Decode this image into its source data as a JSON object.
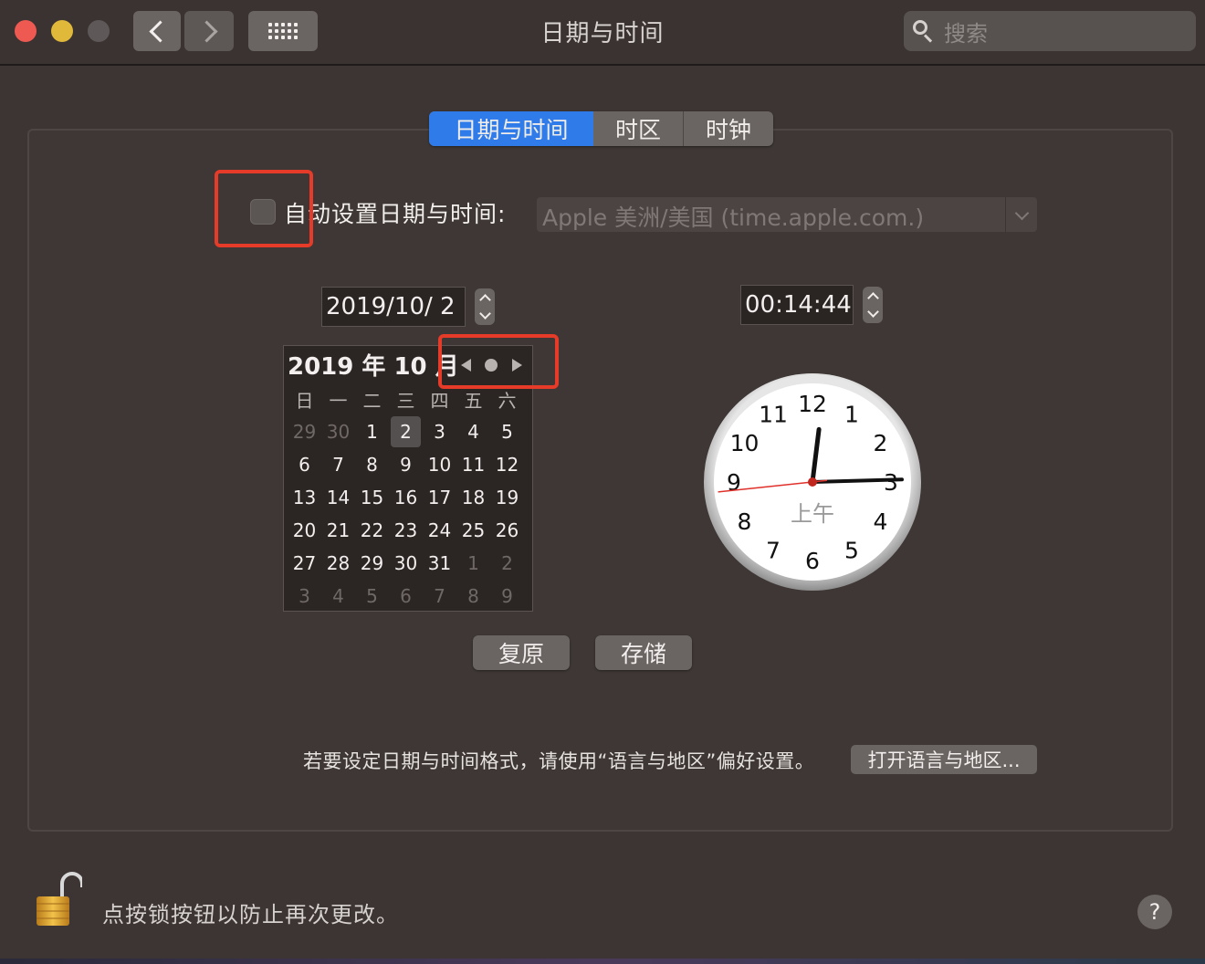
{
  "window": {
    "title": "日期与时间",
    "search_placeholder": "搜索"
  },
  "tabs": [
    {
      "label": "日期与时间",
      "selected": true
    },
    {
      "label": "时区",
      "selected": false
    },
    {
      "label": "时钟",
      "selected": false
    }
  ],
  "auto_set": {
    "label": "自动设置日期与时间:",
    "checked": false,
    "server_value": "Apple 美洲/美国 (time.apple.com.)"
  },
  "date_field": {
    "value": "2019/10/  2"
  },
  "time_field": {
    "value": "00:14:44"
  },
  "calendar": {
    "title": "2019 年 10 月",
    "weekdays": [
      "日",
      "一",
      "二",
      "三",
      "四",
      "五",
      "六"
    ],
    "weeks": [
      [
        "29",
        "30",
        "1",
        "2",
        "3",
        "4",
        "5"
      ],
      [
        "6",
        "7",
        "8",
        "9",
        "10",
        "11",
        "12"
      ],
      [
        "13",
        "14",
        "15",
        "16",
        "17",
        "18",
        "19"
      ],
      [
        "20",
        "21",
        "22",
        "23",
        "24",
        "25",
        "26"
      ],
      [
        "27",
        "28",
        "29",
        "30",
        "31",
        "1",
        "2"
      ],
      [
        "3",
        "4",
        "5",
        "6",
        "7",
        "8",
        "9"
      ]
    ],
    "selected_day": "2"
  },
  "clock": {
    "numbers": [
      "12",
      "1",
      "2",
      "3",
      "4",
      "5",
      "6",
      "7",
      "8",
      "9",
      "10",
      "11"
    ],
    "period": "上午",
    "hour": 0,
    "minute": 14,
    "second": 44
  },
  "buttons": {
    "revert": "复原",
    "save": "存储"
  },
  "format_hint": {
    "text": "若要设定日期与时间格式，请使用“语言与地区”偏好设置。",
    "button": "打开语言与地区..."
  },
  "lock": {
    "text": "点按锁按钮以防止再次更改。"
  },
  "help": {
    "label": "?"
  },
  "colors": {
    "accent": "#2f7bea",
    "highlight_box": "#e53b28",
    "second_hand": "#e0302a"
  }
}
